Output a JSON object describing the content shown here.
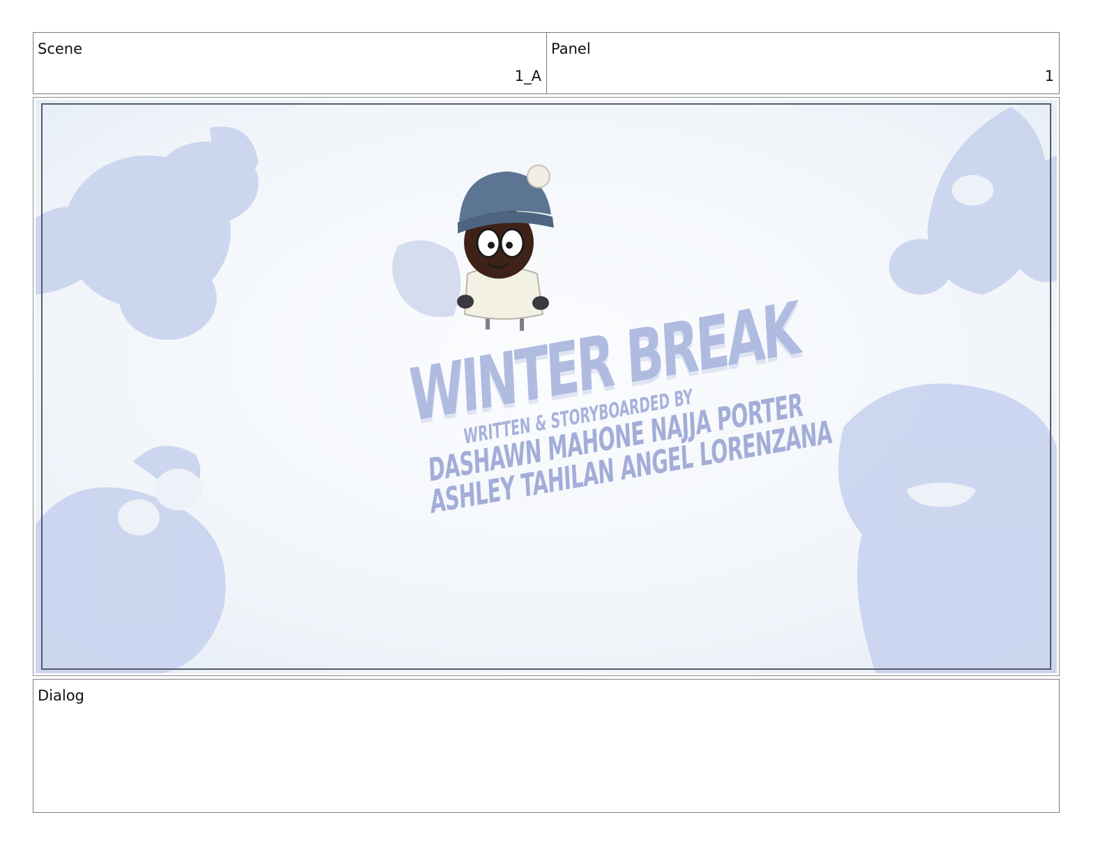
{
  "header": {
    "scene_label": "Scene",
    "scene_value": "1_A",
    "panel_label": "Panel",
    "panel_value": "1"
  },
  "frame": {
    "title": "WINTER BREAK",
    "credit_heading": "WRITTEN & STORYBOARDED BY",
    "credit_names_1": "DASHAWN MAHONE   NAJJA PORTER",
    "credit_names_2": "ASHLEY TAHILAN    ANGEL LORENZANA"
  },
  "dialog": {
    "label": "Dialog"
  },
  "colors": {
    "snow": "#f4f7fb",
    "shadow": "#c9d3ee",
    "title": "#b0bbe0",
    "border": "#55596a"
  }
}
